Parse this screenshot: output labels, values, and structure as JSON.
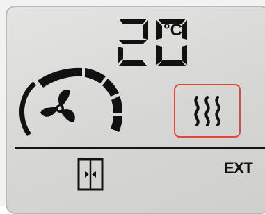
{
  "display": {
    "temperature": "20",
    "unit": "°C",
    "fan_level": 1.0,
    "fan_level_segments": 5,
    "mode": "heating",
    "ext_label": "EXT"
  },
  "colors": {
    "lcd_background": "#d9d9d7",
    "segment": "#111111",
    "active_highlight": "#e0483e"
  },
  "icons": {
    "fan": "fan-icon",
    "heat": "heat-waves-icon",
    "door": "sliding-door-icon"
  }
}
